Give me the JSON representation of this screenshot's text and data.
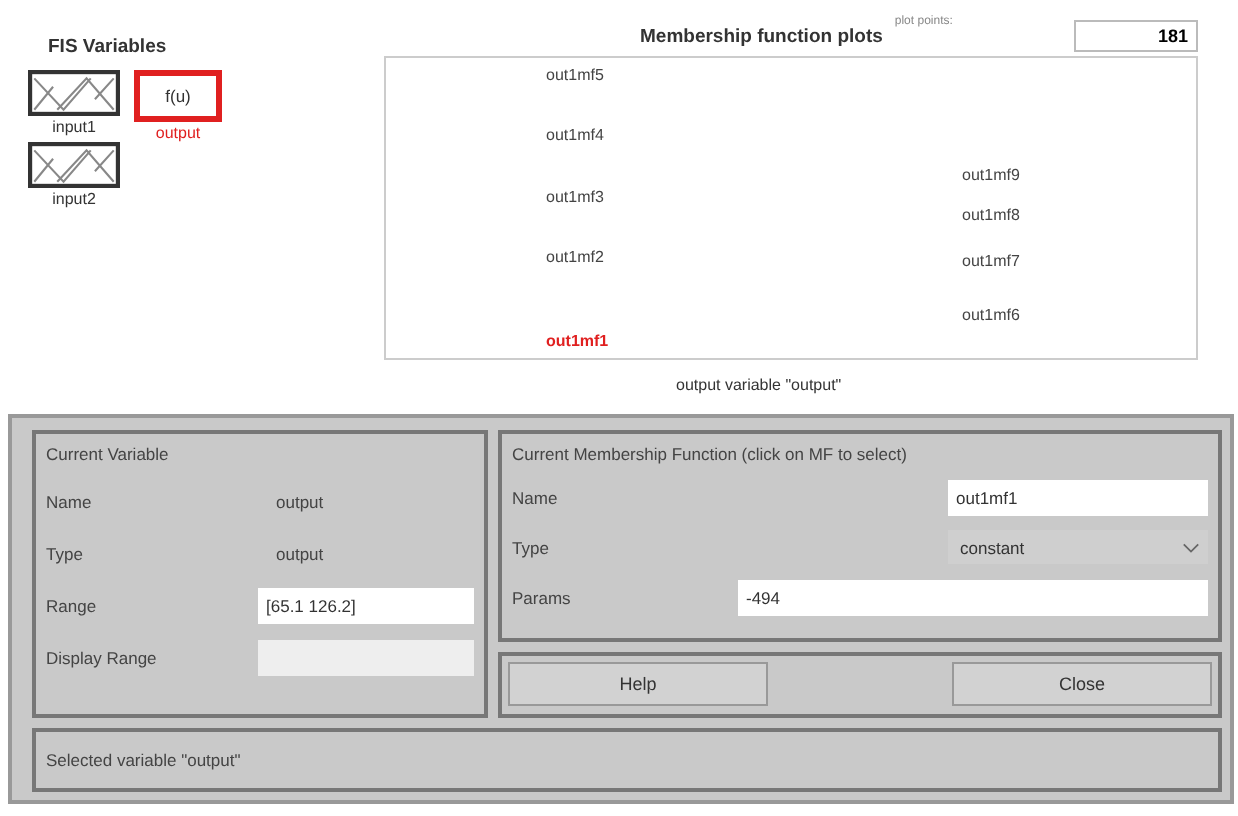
{
  "fis_variables": {
    "title": "FIS Variables",
    "inputs": [
      {
        "label": "input1",
        "selected": false
      },
      {
        "label": "input2",
        "selected": false
      }
    ],
    "output": {
      "symbol": "f(u)",
      "label": "output",
      "selected": true
    }
  },
  "plot": {
    "title": "Membership function plots",
    "plot_points_label": "plot points:",
    "plot_points": "181",
    "caption": "output variable \"output\"",
    "mfs": [
      {
        "label": "out1mf5",
        "selected": false
      },
      {
        "label": "out1mf4",
        "selected": false
      },
      {
        "label": "out1mf9",
        "selected": false
      },
      {
        "label": "out1mf3",
        "selected": false
      },
      {
        "label": "out1mf8",
        "selected": false
      },
      {
        "label": "out1mf2",
        "selected": false
      },
      {
        "label": "out1mf7",
        "selected": false
      },
      {
        "label": "out1mf6",
        "selected": false
      },
      {
        "label": "out1mf1",
        "selected": true
      }
    ]
  },
  "current_variable": {
    "title": "Current Variable",
    "name_label": "Name",
    "name": "output",
    "type_label": "Type",
    "type": "output",
    "range_label": "Range",
    "range": "[65.1 126.2]",
    "display_range_label": "Display Range"
  },
  "current_mf": {
    "title": "Current Membership Function (click on MF to select)",
    "name_label": "Name",
    "name": "out1mf1",
    "type_label": "Type",
    "type": "constant",
    "params_label": "Params",
    "params": "-494"
  },
  "buttons": [
    "Help",
    "Close"
  ],
  "status": "Selected variable \"output\""
}
